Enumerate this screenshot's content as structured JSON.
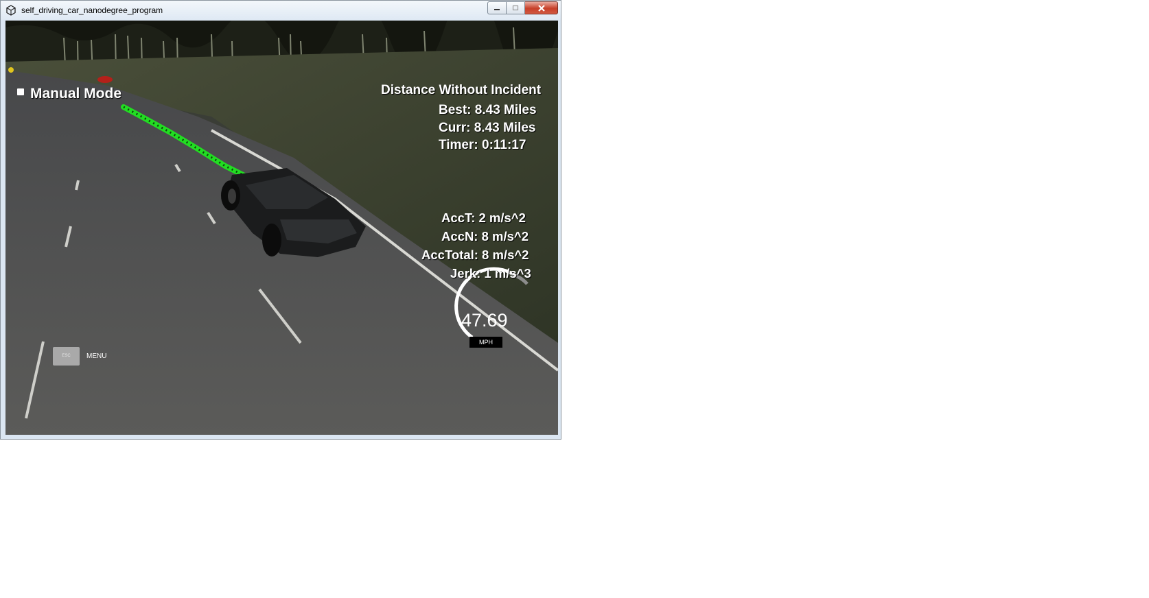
{
  "window": {
    "title": "self_driving_car_nanodegree_program",
    "controls": {
      "minimize": "minimize",
      "maximize": "maximize",
      "close": "close"
    }
  },
  "hud": {
    "mode_label": "Manual Mode",
    "distance_title": "Distance Without Incident",
    "best": "Best: 8.43 Miles",
    "curr": "Curr: 8.43 Miles",
    "timer": "Timer: 0:11:17",
    "acc_t": "AccT: 2 m/s^2",
    "acc_n": "AccN: 8 m/s^2",
    "acc_total": "AccTotal: 8 m/s^2",
    "jerk": "Jerk: 1 m/s^3"
  },
  "speedometer": {
    "value": "47.69",
    "unit": "MPH"
  },
  "menu": {
    "key_label": "ESC",
    "label": "MENU"
  },
  "icons": {
    "app": "unity-icon",
    "minimize": "minimize-icon",
    "maximize": "maximize-icon",
    "close": "close-icon"
  },
  "colors": {
    "path": "#22dd22",
    "hud_text": "#ffffff",
    "road": "#5a5a57",
    "grass": "#3f4632",
    "close_button": "#c7402a"
  }
}
